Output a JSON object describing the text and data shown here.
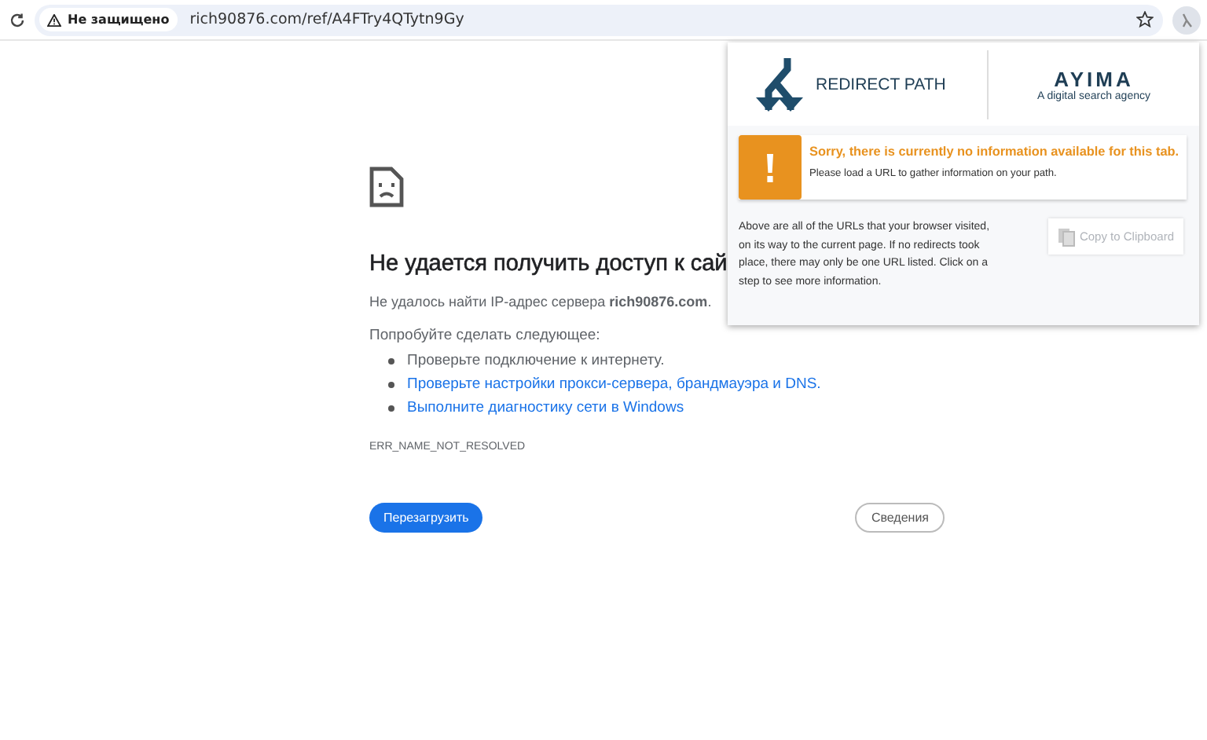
{
  "toolbar": {
    "security_label": "Не защищено",
    "url": "rich90876.com/ref/A4FTry4QTytn9Gy"
  },
  "page": {
    "heading": "Не удается получить доступ к сай",
    "message": "Не удалось найти IP-адрес сервера **rich90876.com**.",
    "suggestions_title": "Попробуйте сделать следующее:",
    "suggestions": [
      {
        "kind": "text",
        "label": "Проверьте подключение к интернету."
      },
      {
        "kind": "link",
        "label": "Проверьте настройки прокси-сервера, брандмауэра и DNS."
      },
      {
        "kind": "link",
        "label": "Выполните диагностику сети в Windows"
      }
    ],
    "error_code": "ERR_NAME_NOT_RESOLVED",
    "buttons": [
      {
        "kind": "primary",
        "label": "Перезагрузить"
      },
      {
        "kind": "secondary",
        "label": "Сведения"
      }
    ]
  },
  "popup": {
    "logo_text": "REDIRECT PATH",
    "brand": "AYIMA",
    "brand_tagline": "A digital search agency",
    "alert_title": "Sorry, there is currently no information available for this tab.",
    "alert_text": "Please load a URL to gather information on your path.",
    "description": "Above are all of the URLs that your browser visited, on its way to the current page. If no redirects took place, there may only be one URL listed. Click on a step to see more information.",
    "copy_button": {
      "label": "Copy to Clipboard",
      "disabled": true
    }
  }
}
